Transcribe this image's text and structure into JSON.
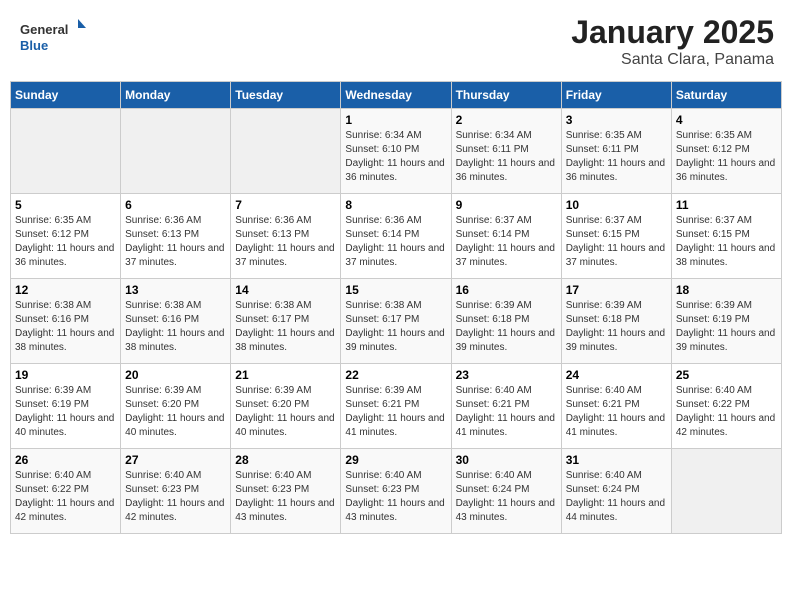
{
  "header": {
    "title": "January 2025",
    "subtitle": "Santa Clara, Panama",
    "logo_text_general": "General",
    "logo_text_blue": "Blue"
  },
  "weekdays": [
    "Sunday",
    "Monday",
    "Tuesday",
    "Wednesday",
    "Thursday",
    "Friday",
    "Saturday"
  ],
  "weeks": [
    [
      {
        "day": "",
        "sunrise": "",
        "sunset": "",
        "daylight": ""
      },
      {
        "day": "",
        "sunrise": "",
        "sunset": "",
        "daylight": ""
      },
      {
        "day": "",
        "sunrise": "",
        "sunset": "",
        "daylight": ""
      },
      {
        "day": "1",
        "sunrise": "Sunrise: 6:34 AM",
        "sunset": "Sunset: 6:10 PM",
        "daylight": "Daylight: 11 hours and 36 minutes."
      },
      {
        "day": "2",
        "sunrise": "Sunrise: 6:34 AM",
        "sunset": "Sunset: 6:11 PM",
        "daylight": "Daylight: 11 hours and 36 minutes."
      },
      {
        "day": "3",
        "sunrise": "Sunrise: 6:35 AM",
        "sunset": "Sunset: 6:11 PM",
        "daylight": "Daylight: 11 hours and 36 minutes."
      },
      {
        "day": "4",
        "sunrise": "Sunrise: 6:35 AM",
        "sunset": "Sunset: 6:12 PM",
        "daylight": "Daylight: 11 hours and 36 minutes."
      }
    ],
    [
      {
        "day": "5",
        "sunrise": "Sunrise: 6:35 AM",
        "sunset": "Sunset: 6:12 PM",
        "daylight": "Daylight: 11 hours and 36 minutes."
      },
      {
        "day": "6",
        "sunrise": "Sunrise: 6:36 AM",
        "sunset": "Sunset: 6:13 PM",
        "daylight": "Daylight: 11 hours and 37 minutes."
      },
      {
        "day": "7",
        "sunrise": "Sunrise: 6:36 AM",
        "sunset": "Sunset: 6:13 PM",
        "daylight": "Daylight: 11 hours and 37 minutes."
      },
      {
        "day": "8",
        "sunrise": "Sunrise: 6:36 AM",
        "sunset": "Sunset: 6:14 PM",
        "daylight": "Daylight: 11 hours and 37 minutes."
      },
      {
        "day": "9",
        "sunrise": "Sunrise: 6:37 AM",
        "sunset": "Sunset: 6:14 PM",
        "daylight": "Daylight: 11 hours and 37 minutes."
      },
      {
        "day": "10",
        "sunrise": "Sunrise: 6:37 AM",
        "sunset": "Sunset: 6:15 PM",
        "daylight": "Daylight: 11 hours and 37 minutes."
      },
      {
        "day": "11",
        "sunrise": "Sunrise: 6:37 AM",
        "sunset": "Sunset: 6:15 PM",
        "daylight": "Daylight: 11 hours and 38 minutes."
      }
    ],
    [
      {
        "day": "12",
        "sunrise": "Sunrise: 6:38 AM",
        "sunset": "Sunset: 6:16 PM",
        "daylight": "Daylight: 11 hours and 38 minutes."
      },
      {
        "day": "13",
        "sunrise": "Sunrise: 6:38 AM",
        "sunset": "Sunset: 6:16 PM",
        "daylight": "Daylight: 11 hours and 38 minutes."
      },
      {
        "day": "14",
        "sunrise": "Sunrise: 6:38 AM",
        "sunset": "Sunset: 6:17 PM",
        "daylight": "Daylight: 11 hours and 38 minutes."
      },
      {
        "day": "15",
        "sunrise": "Sunrise: 6:38 AM",
        "sunset": "Sunset: 6:17 PM",
        "daylight": "Daylight: 11 hours and 39 minutes."
      },
      {
        "day": "16",
        "sunrise": "Sunrise: 6:39 AM",
        "sunset": "Sunset: 6:18 PM",
        "daylight": "Daylight: 11 hours and 39 minutes."
      },
      {
        "day": "17",
        "sunrise": "Sunrise: 6:39 AM",
        "sunset": "Sunset: 6:18 PM",
        "daylight": "Daylight: 11 hours and 39 minutes."
      },
      {
        "day": "18",
        "sunrise": "Sunrise: 6:39 AM",
        "sunset": "Sunset: 6:19 PM",
        "daylight": "Daylight: 11 hours and 39 minutes."
      }
    ],
    [
      {
        "day": "19",
        "sunrise": "Sunrise: 6:39 AM",
        "sunset": "Sunset: 6:19 PM",
        "daylight": "Daylight: 11 hours and 40 minutes."
      },
      {
        "day": "20",
        "sunrise": "Sunrise: 6:39 AM",
        "sunset": "Sunset: 6:20 PM",
        "daylight": "Daylight: 11 hours and 40 minutes."
      },
      {
        "day": "21",
        "sunrise": "Sunrise: 6:39 AM",
        "sunset": "Sunset: 6:20 PM",
        "daylight": "Daylight: 11 hours and 40 minutes."
      },
      {
        "day": "22",
        "sunrise": "Sunrise: 6:39 AM",
        "sunset": "Sunset: 6:21 PM",
        "daylight": "Daylight: 11 hours and 41 minutes."
      },
      {
        "day": "23",
        "sunrise": "Sunrise: 6:40 AM",
        "sunset": "Sunset: 6:21 PM",
        "daylight": "Daylight: 11 hours and 41 minutes."
      },
      {
        "day": "24",
        "sunrise": "Sunrise: 6:40 AM",
        "sunset": "Sunset: 6:21 PM",
        "daylight": "Daylight: 11 hours and 41 minutes."
      },
      {
        "day": "25",
        "sunrise": "Sunrise: 6:40 AM",
        "sunset": "Sunset: 6:22 PM",
        "daylight": "Daylight: 11 hours and 42 minutes."
      }
    ],
    [
      {
        "day": "26",
        "sunrise": "Sunrise: 6:40 AM",
        "sunset": "Sunset: 6:22 PM",
        "daylight": "Daylight: 11 hours and 42 minutes."
      },
      {
        "day": "27",
        "sunrise": "Sunrise: 6:40 AM",
        "sunset": "Sunset: 6:23 PM",
        "daylight": "Daylight: 11 hours and 42 minutes."
      },
      {
        "day": "28",
        "sunrise": "Sunrise: 6:40 AM",
        "sunset": "Sunset: 6:23 PM",
        "daylight": "Daylight: 11 hours and 43 minutes."
      },
      {
        "day": "29",
        "sunrise": "Sunrise: 6:40 AM",
        "sunset": "Sunset: 6:23 PM",
        "daylight": "Daylight: 11 hours and 43 minutes."
      },
      {
        "day": "30",
        "sunrise": "Sunrise: 6:40 AM",
        "sunset": "Sunset: 6:24 PM",
        "daylight": "Daylight: 11 hours and 43 minutes."
      },
      {
        "day": "31",
        "sunrise": "Sunrise: 6:40 AM",
        "sunset": "Sunset: 6:24 PM",
        "daylight": "Daylight: 11 hours and 44 minutes."
      },
      {
        "day": "",
        "sunrise": "",
        "sunset": "",
        "daylight": ""
      }
    ]
  ]
}
